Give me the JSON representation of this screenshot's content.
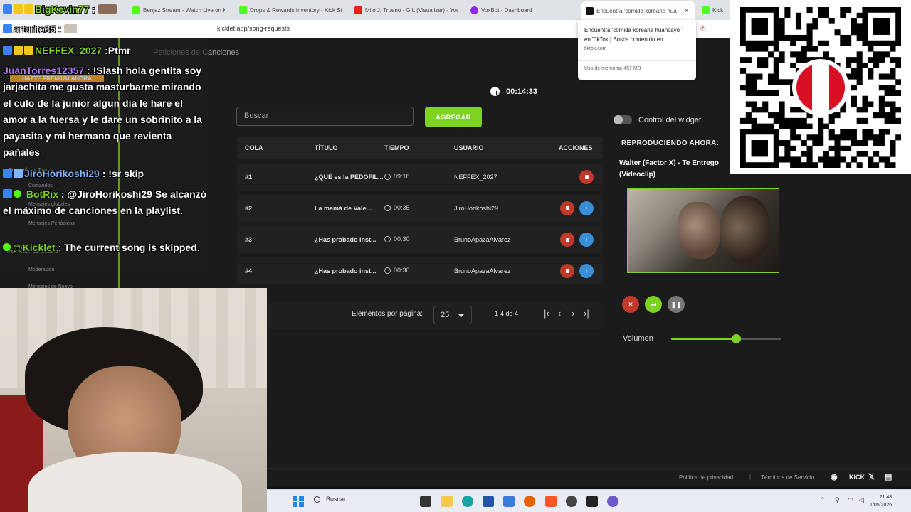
{
  "browser": {
    "tabs": [
      {
        "label": "Benjaz Stream - Watch Live on K"
      },
      {
        "label": "Drops & Rewards Inventory - Kick St"
      },
      {
        "label": "Milo J, Trueno - GIL (Visualizer) - You"
      },
      {
        "label": "VoxBot - Dashboard"
      },
      {
        "label": "Encuentra 'comida koreana hua"
      },
      {
        "label": "Kick"
      }
    ],
    "url": "kicklet.app/song-requests",
    "hover_card": {
      "title": "Encuentra 'comida koreana huancayo ' en TikTok | Busca contenido en ...",
      "domain": "tiktok.com",
      "memory": "Uso de memoria: 457 MB"
    }
  },
  "app": {
    "page_title": "Peticiones de Canciones",
    "timer": "00:14:33",
    "search_placeholder": "Buscar",
    "add_button": "AGREGAR",
    "columns": [
      "COLA",
      "TÍTULO",
      "TIEMPO",
      "USUARIO",
      "ACCIONES"
    ],
    "rows": [
      {
        "pos": "#1",
        "title": "¿QUÉ es la PEDOFIL...",
        "time": "09:18",
        "user": "NEFFEX_2027",
        "can_move_up": false
      },
      {
        "pos": "#2",
        "title": "La mamá de Vale...",
        "time": "00:35",
        "user": "JiroHorikoshi29",
        "can_move_up": true
      },
      {
        "pos": "#3",
        "title": "¿Has probado inst...",
        "time": "00:30",
        "user": "BrunoApazaAlvarez",
        "can_move_up": true
      },
      {
        "pos": "#4",
        "title": "¿Has probado inst...",
        "time": "00:30",
        "user": "BrunoApazaAlvarez",
        "can_move_up": true
      }
    ],
    "pagination": {
      "label": "Elementos por página:",
      "page_size": "25",
      "range": "1-4 de 4"
    },
    "widget": {
      "control_label": "Control del widget",
      "now_playing_label": "REPRODUCIENDO AHORA:",
      "song_title": "Walter (Factor X) - Te Entrego (Videoclip)",
      "volume_label": "Volumen",
      "volume_level": 0.59
    },
    "footer": {
      "privacy": "Política de privacidad",
      "separator": "|",
      "terms": "Términos de Servicio"
    }
  },
  "chat": {
    "messages": [
      {
        "user": "BigKevin77",
        "sep": ":",
        "text": ""
      },
      {
        "user": "arturito35",
        "sep": ":",
        "text": ""
      },
      {
        "user": "NEFFEX_2027",
        "sep": ":",
        "text": "Ptmr"
      },
      {
        "user": "JuanTorres12357",
        "sep": ":",
        "text": "!Slash hola gentita soy jarjachita me gusta masturbarme mirando el culo de la junior algun dia le hare el amor a la fuersa y le dare un sobrinito a la payasita y mi hermano que revienta pañales"
      },
      {
        "user": "JiroHorikoshi29",
        "sep": ":",
        "text": "!sr skip"
      },
      {
        "user": "BotRix",
        "sep": ":",
        "text": "@JiroHorikoshi29 Se alcanzó el máximo de canciones en la playlist."
      },
      {
        "user": "@Kicklet",
        "sep": ":",
        "text": "The current song is skipped."
      }
    ],
    "premium_banner": "HAZTE PREMIUM AHORA",
    "menu_ghosts": [
      "Comandos y Timers",
      "Comandos",
      "Mensajes globales",
      "Mensajes Periódicos",
      "Interacción del Usuario",
      "Moderación",
      "Mensajes de Nuevo"
    ]
  },
  "taskbar": {
    "search": "Buscar",
    "time": "21:48",
    "date": "1/05/2026"
  },
  "colors": {
    "accent": "#7ed321",
    "delete": "#c0392b",
    "move_up": "#3a8fd6"
  }
}
